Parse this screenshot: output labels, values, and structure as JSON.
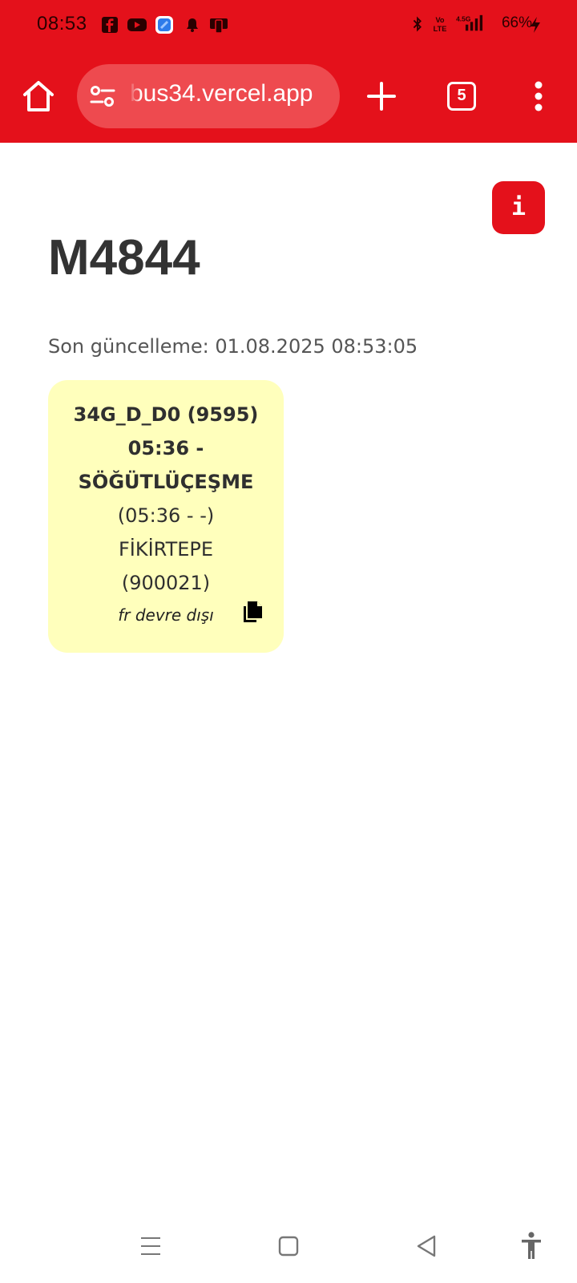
{
  "status_bar": {
    "time": "08:53",
    "battery": "66%",
    "notification_icons": [
      "facebook-icon",
      "youtube-icon",
      "app-icon",
      "bell-icon",
      "device-icon"
    ],
    "system_icons": [
      "bluetooth-icon",
      "volte-icon",
      "signal-icon",
      "battery-charging-icon"
    ],
    "network_label": "4.5G"
  },
  "browser": {
    "url": "bus34.vercel.app",
    "tab_count": "5",
    "icons": [
      "home-icon",
      "site-settings-icon",
      "new-tab-icon",
      "tabs-icon",
      "menu-icon"
    ],
    "accent_color": "#e4111b"
  },
  "page": {
    "info_label": "i",
    "title": "M4844",
    "last_update": "Son güncelleme: 01.08.2025 08:53:05",
    "card": {
      "line1": "34G_D_D0 (9595)",
      "line2": "05:36 -",
      "line3": "SÖĞÜTLÜÇEŞME",
      "line4": "(05:36 - -)",
      "line5": "FİKİRTEPE",
      "line6": "(900021)",
      "note": "fr devre dışı",
      "background": "#ffffbc"
    }
  },
  "nav_bar": {
    "icons": [
      "recents-icon",
      "home-nav-icon",
      "back-icon",
      "accessibility-icon"
    ]
  }
}
